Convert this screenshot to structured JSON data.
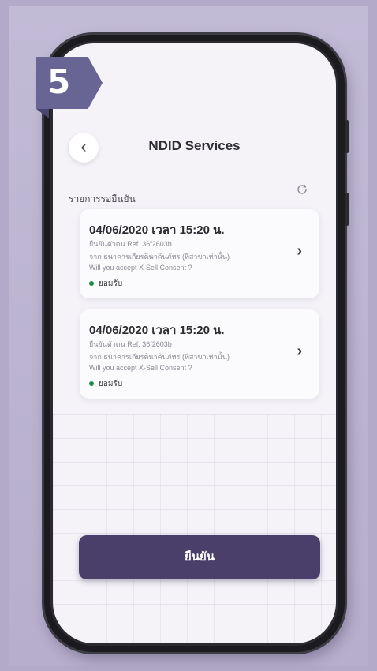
{
  "step": "5",
  "header": {
    "title": "NDID Services",
    "back_icon": "chevron-left-icon"
  },
  "section": {
    "label": "รายการรอยืนยัน",
    "refresh_icon": "refresh-icon"
  },
  "cards": [
    {
      "date": "04/06/2020 เวลา 15:20 น.",
      "lines": [
        "ยืนยันตัวตน Ref. 36f2603b",
        "จาก ธนาคารเกียรตินาคินภัทร (ที่สาขาเท่านั้น)",
        "Will you accept X-Sell Consent ?"
      ],
      "status": "ยอมรับ"
    },
    {
      "date": "04/06/2020 เวลา 15:20 น.",
      "lines": [
        "ยืนยันตัวตน Ref. 36f2603b",
        "จาก ธนาคารเกียรตินาคินภัทร (ที่สาขาเท่านั้น)",
        "Will you accept X-Sell Consent ?"
      ],
      "status": "ยอมรับ"
    }
  ],
  "confirm_button": "ยืนยัน",
  "colors": {
    "accent": "#4a3f6a",
    "status_dot": "#1f8a4c",
    "badge": "#686493"
  }
}
